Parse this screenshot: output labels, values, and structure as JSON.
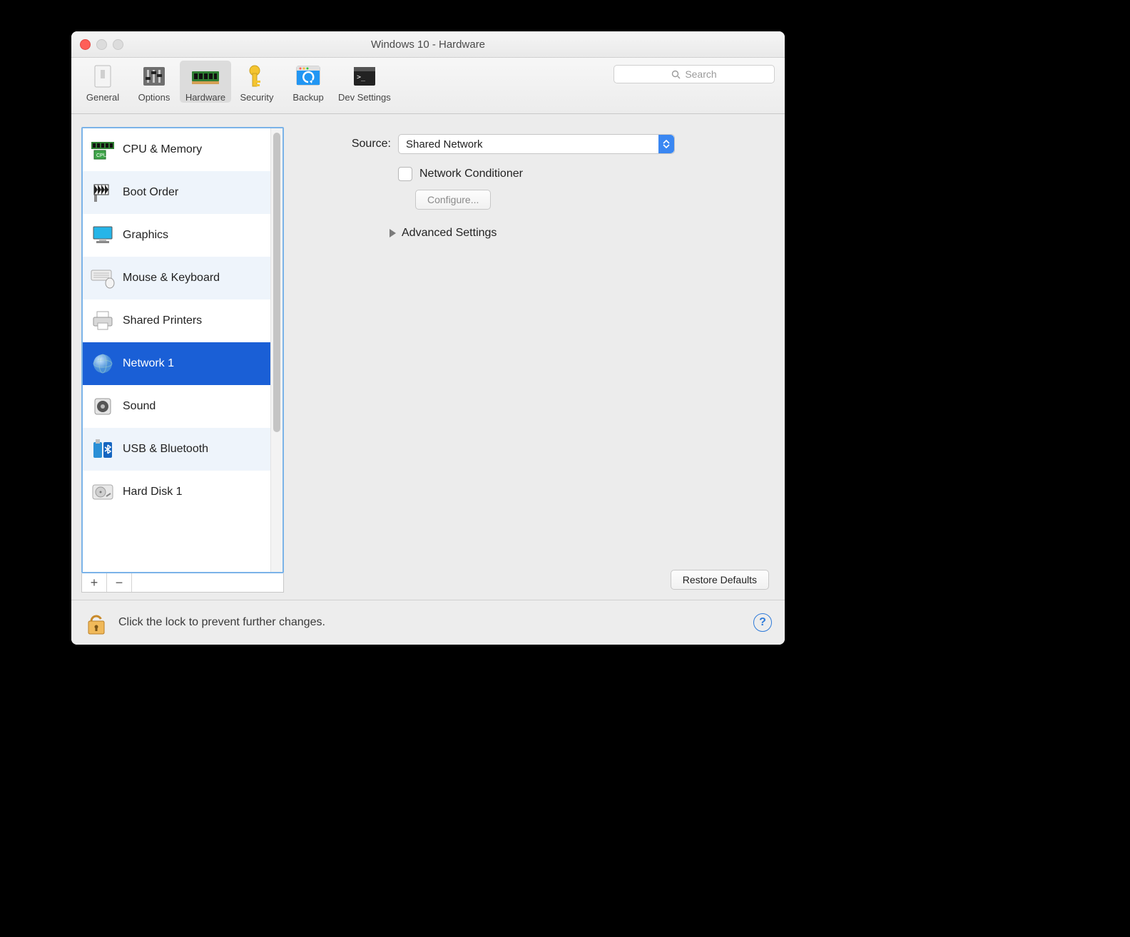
{
  "window": {
    "title": "Windows 10 - Hardware"
  },
  "toolbar": {
    "items": [
      {
        "label": "General"
      },
      {
        "label": "Options"
      },
      {
        "label": "Hardware"
      },
      {
        "label": "Security"
      },
      {
        "label": "Backup"
      },
      {
        "label": "Dev Settings"
      }
    ],
    "active_index": 2,
    "search_placeholder": "Search"
  },
  "sidebar": {
    "items": [
      {
        "label": "CPU & Memory"
      },
      {
        "label": "Boot Order"
      },
      {
        "label": "Graphics"
      },
      {
        "label": "Mouse & Keyboard"
      },
      {
        "label": "Shared Printers"
      },
      {
        "label": "Network 1"
      },
      {
        "label": "Sound"
      },
      {
        "label": "USB & Bluetooth"
      },
      {
        "label": "Hard Disk 1"
      }
    ],
    "selected_index": 5,
    "add_label": "+",
    "remove_label": "−"
  },
  "panel": {
    "source_label": "Source:",
    "source_value": "Shared Network",
    "network_conditioner_label": "Network Conditioner",
    "network_conditioner_checked": false,
    "configure_label": "Configure...",
    "advanced_label": "Advanced Settings",
    "restore_label": "Restore Defaults"
  },
  "footer": {
    "lock_text": "Click the lock to prevent further changes.",
    "help_label": "?"
  }
}
